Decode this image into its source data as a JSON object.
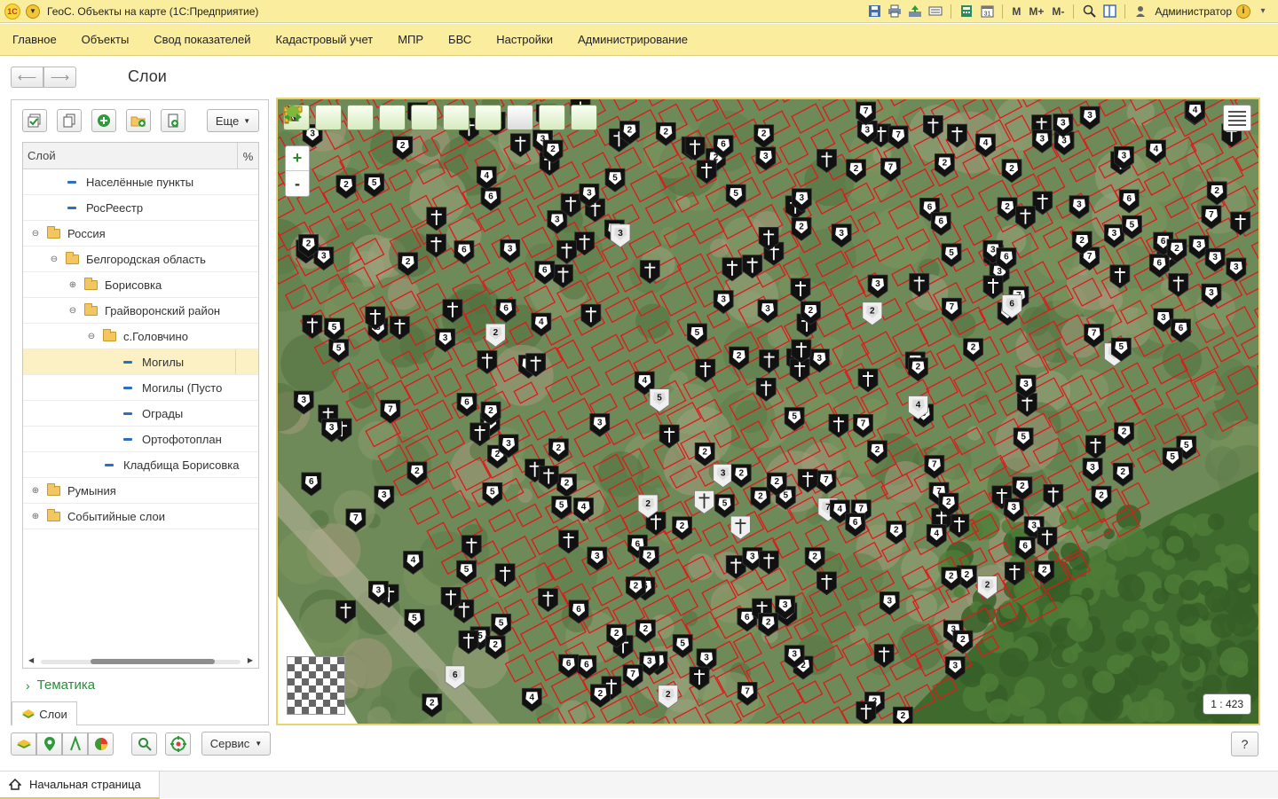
{
  "window": {
    "title": "ГеоС. Объекты на карте  (1С:Предприятие)",
    "logo_text": "1C",
    "user": "Администратор",
    "tools": [
      "M",
      "M+",
      "M-"
    ]
  },
  "sections": [
    {
      "label": "Главное"
    },
    {
      "label": "Объекты"
    },
    {
      "label": "Свод показателей"
    },
    {
      "label": "Кадастровый учет"
    },
    {
      "label": "МПР"
    },
    {
      "label": "БВС"
    },
    {
      "label": "Настройки"
    },
    {
      "label": "Администрирование"
    }
  ],
  "page": {
    "title": "Слои"
  },
  "layers_panel": {
    "more_label": "Еще",
    "col_layer": "Слой",
    "col_pct": "%",
    "rows": [
      {
        "label": "Населённые пункты",
        "type": "layer",
        "expander": ""
      },
      {
        "label": "РосРеестр",
        "type": "layer",
        "expander": ""
      },
      {
        "label": "Россия",
        "type": "folder",
        "expander": "⊖"
      },
      {
        "label": "Белгородская область",
        "type": "folder",
        "expander": "⊖"
      },
      {
        "label": "Борисовка",
        "type": "folder",
        "expander": "⊕"
      },
      {
        "label": "Грайворонский район",
        "type": "folder",
        "expander": "⊖"
      },
      {
        "label": "с.Головчино",
        "type": "folder",
        "expander": "⊖"
      },
      {
        "label": "Могилы",
        "type": "layer",
        "expander": "",
        "selected": true
      },
      {
        "label": "Могилы (Пусто",
        "type": "layer",
        "expander": ""
      },
      {
        "label": "Ограды",
        "type": "layer",
        "expander": ""
      },
      {
        "label": "Ортофотоплан",
        "type": "layer",
        "expander": ""
      },
      {
        "label": "Кладбища Борисовка",
        "type": "layer",
        "expander": ""
      },
      {
        "label": "Румыния",
        "type": "folder",
        "expander": "⊕"
      },
      {
        "label": "Событийные слои",
        "type": "folder",
        "expander": "⊕"
      }
    ],
    "thematic_label": "Тематика",
    "tab_label": "Слои"
  },
  "map": {
    "zoom_in": "+",
    "zoom_out": "-",
    "scale": "1 : 423",
    "toolbar_icons": [
      "home-icon",
      "info-icon",
      "pan-icon",
      "measure-length-icon",
      "measure-area-icon",
      "ruler-icon",
      "filter-icon",
      "select-icon",
      "back-icon",
      "forward-icon"
    ]
  },
  "bottom": {
    "service_label": "Сервис",
    "help_label": "?"
  },
  "window_bar": {
    "home_tab": "Начальная страница"
  },
  "colors": {
    "accent": "#fbed9e",
    "map_border": "#e8d36f",
    "selection": "#fbf1c4",
    "plot_lines": "#e01919"
  }
}
